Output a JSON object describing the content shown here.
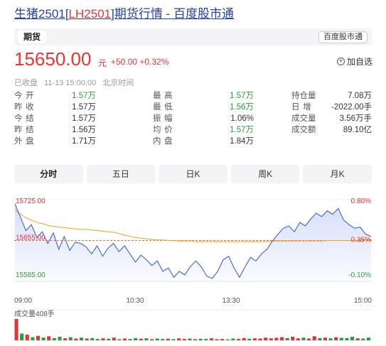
{
  "header": {
    "title_prefix": "生猪2501[",
    "title_code": "LH2501",
    "title_suffix": "]期货行情 - 百度股市通",
    "type_tab": "期货",
    "source_tag": "百度股市通"
  },
  "quote": {
    "price": "15650.00",
    "unit": "元",
    "change": "+50.00 +0.32%",
    "add_watch": "加自选"
  },
  "status": {
    "state": "已收盘",
    "time": "11-13 15:00:00",
    "zone": "北京时间"
  },
  "stats": {
    "c1": [
      {
        "label": "今开",
        "value": "1.57万",
        "color": "down"
      },
      {
        "label": "昨收",
        "value": "1.57万",
        "color": "neutral"
      },
      {
        "label": "今结",
        "value": "1.57万",
        "color": "neutral"
      },
      {
        "label": "昨结",
        "value": "1.56万",
        "color": "neutral"
      },
      {
        "label": "外盘",
        "value": "1.71万",
        "color": "neutral"
      }
    ],
    "c2": [
      {
        "label": "最高",
        "value": "1.57万",
        "color": "down"
      },
      {
        "label": "最低",
        "value": "1.56万",
        "color": "down"
      },
      {
        "label": "振幅",
        "value": "1.06%",
        "color": "neutral"
      },
      {
        "label": "均价",
        "value": "1.57万",
        "color": "down"
      },
      {
        "label": "内盘",
        "value": "1.84万",
        "color": "neutral"
      }
    ],
    "c3": [
      {
        "label": "持仓量",
        "value": "7.08万",
        "color": "neutral"
      },
      {
        "label": "日增",
        "value": "-2022.00手",
        "color": "neutral"
      },
      {
        "label": "成交量",
        "value": "3.56万手",
        "color": "neutral"
      },
      {
        "label": "成交额",
        "value": "89.10亿",
        "color": "neutral"
      }
    ]
  },
  "tabs": [
    "分时",
    "五日",
    "日K",
    "周K",
    "月K"
  ],
  "colors": {
    "up": "#e33333",
    "down": "#2a9d3a",
    "price_line": "#3a62d7",
    "avg_line": "#f0a020",
    "ref_line": "#f07030"
  },
  "chart_data": {
    "type": "line",
    "y_ticks": [
      "15725.00",
      "15655.00",
      "15585.00"
    ],
    "pct_ticks": [
      "0.80%",
      "0.35%",
      "-0.10%"
    ],
    "ylim": [
      15585,
      15725
    ],
    "x_ticks": [
      "09:00",
      "10:30",
      "13:30",
      "15:00"
    ],
    "volume_label": "成交量408手",
    "series": [
      {
        "values": [
          15718,
          15695,
          15672,
          15682,
          15660,
          15670,
          15650,
          15668,
          15640,
          15662,
          15638,
          15652,
          15650,
          15644,
          15632,
          15646,
          15628,
          15642,
          15650,
          15636,
          15646,
          15632,
          15618,
          15630,
          15622,
          15612,
          15620,
          15602,
          15608,
          15592,
          15602,
          15596,
          15610,
          15620,
          15610,
          15594,
          15590,
          15602,
          15622,
          15628,
          15608,
          15592,
          15610,
          15626,
          15620,
          15632,
          15640,
          15654,
          15666,
          15676,
          15680,
          15670,
          15686,
          15680,
          15692,
          15702,
          15696,
          15706,
          15700,
          15710,
          15690,
          15682,
          15676,
          15678,
          15666,
          15662
        ]
      },
      {
        "values": [
          15708,
          15700,
          15694,
          15690,
          15686,
          15684,
          15681,
          15679,
          15678,
          15677,
          15676,
          15675,
          15674,
          15674,
          15673,
          15672,
          15671,
          15670,
          15669,
          15667,
          15664,
          15662,
          15660,
          15659,
          15658,
          15657,
          15656,
          15656,
          15655,
          15655,
          15654,
          15654,
          15654,
          15653,
          15653,
          15653,
          15653,
          15653,
          15653,
          15653,
          15653,
          15653,
          15653,
          15653,
          15653,
          15653,
          15653,
          15654,
          15654,
          15654,
          15654,
          15654,
          15654,
          15654,
          15654,
          15654,
          15654,
          15655,
          15655,
          15655,
          15655,
          15655,
          15655,
          15656,
          15656,
          15656
        ]
      }
    ],
    "reference": 15655,
    "volumes": [
      95,
      30,
      25,
      14,
      20,
      12,
      18,
      10,
      16,
      9,
      14,
      8,
      12,
      8,
      10,
      6,
      9,
      7,
      12,
      5,
      8,
      6,
      10,
      7,
      9,
      5,
      8,
      6,
      7,
      5,
      9,
      6,
      8,
      5,
      7,
      6,
      9,
      5,
      6,
      4,
      8,
      6,
      10,
      7,
      9,
      8,
      12,
      9,
      11,
      14,
      10,
      16,
      9,
      12,
      8,
      18,
      10,
      12,
      9,
      14,
      11,
      10,
      16,
      9,
      8,
      12
    ],
    "volume_colors": [
      "up",
      "down",
      "up",
      "down",
      "up",
      "down",
      "up",
      "down",
      "down",
      "up",
      "down",
      "up",
      "down",
      "up",
      "down",
      "down",
      "up",
      "down",
      "up",
      "down",
      "up",
      "down",
      "down",
      "up",
      "down",
      "up",
      "down",
      "down",
      "up",
      "down",
      "up",
      "up",
      "down",
      "up",
      "down",
      "down",
      "up",
      "up",
      "up",
      "down",
      "down",
      "up",
      "up",
      "down",
      "up",
      "up",
      "up",
      "up",
      "up",
      "up",
      "down",
      "up",
      "up",
      "down",
      "up",
      "up",
      "down",
      "up",
      "down",
      "up",
      "down",
      "down",
      "down",
      "up",
      "down",
      "down"
    ]
  }
}
